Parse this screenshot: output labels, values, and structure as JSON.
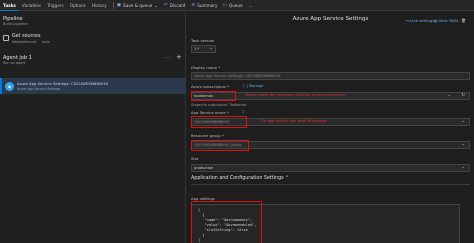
{
  "topbar": {
    "tabs": [
      "Tasks",
      "Variables",
      "Triggers",
      "Options",
      "History"
    ],
    "save_label": "Save & queue",
    "discard_label": "Discard",
    "summary_label": "Summary",
    "queue_label": "Queue",
    "more_label": "..."
  },
  "left": {
    "pipeline_title": "Pipeline",
    "pipeline_sub": "Build pipeline",
    "get_sources": "Get sources",
    "get_sources_repo": "Newsletter.net",
    "get_sources_branch": "main",
    "agent_job_title": "Agent job 1",
    "agent_job_sub": "Run on agent",
    "task_name": "Azure App Service Settings: CDCUWEXNNNB!44",
    "task_sub": "Azure App Service Settings"
  },
  "right": {
    "title": "Azure App Service Settings",
    "link_settings": "Link settings",
    "view_yaml": "View YAML",
    "remove": "Remove",
    "task_version_label": "Task version",
    "task_version_value": "1.*",
    "display_name_label": "Display name *",
    "display_name_value": "Azure App Service Settings: CDCUWEXNNNB!44",
    "subscription_label": "Azure subscription *",
    "manage_label": "Manage",
    "subscription_value": "toolbeman",
    "subscription_annotation": "Please select the necessary DevOps service connection",
    "subscription_scope": "Scoped to subscription 'Toolbeman'",
    "app_service_label": "App Service name *",
    "app_service_value": "CDCUWEXNNNB!44",
    "app_service_annotation": "The app service you want to manage",
    "resource_group_label": "Resource group *",
    "resource_group_value": "CDCUWEXNNNB!44_group",
    "slot_label": "Slot",
    "slot_value": "production",
    "section_title": "Application and Configuration Settings",
    "app_settings_label": "App settings",
    "code_lines": [
      "[",
      "  {",
      "   \"name\": \"$ovnnamekey\",",
      "   \"value\": \"$ovnmenabled\",",
      "   \"slotSetting\": false",
      "  }",
      "]"
    ]
  },
  "colors": {
    "accent": "#0a78d4",
    "annotation_red": "#e23030"
  }
}
